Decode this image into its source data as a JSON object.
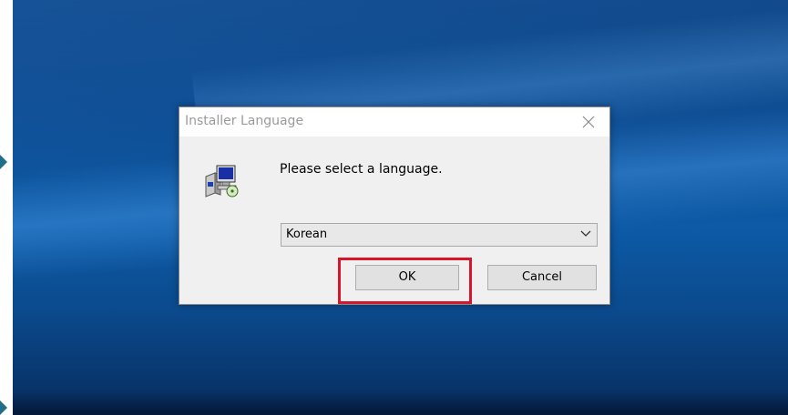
{
  "dialog": {
    "title": "Installer Language",
    "prompt": "Please select a language.",
    "language_select": {
      "selected": "Korean"
    },
    "buttons": {
      "ok_label": "OK",
      "cancel_label": "Cancel"
    },
    "icons": {
      "app_icon": "installer-computer-icon",
      "close_icon": "close-icon",
      "dropdown_icon": "chevron-down-icon"
    }
  },
  "annotation": {
    "highlight_target": "OK button",
    "highlight_color": "#d8152a"
  },
  "colors": {
    "desktop_blue": "#0d5aa6",
    "dialog_bg": "#f0f0f0",
    "title_text": "#9a9a9a"
  }
}
